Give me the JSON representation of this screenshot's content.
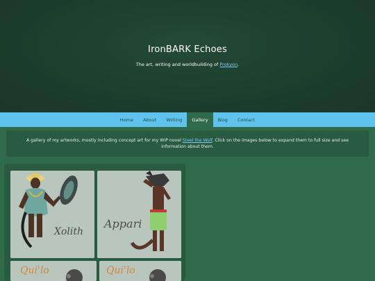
{
  "site": {
    "title": "IronBARK Echoes",
    "tagline_prefix": "The art, writing and worldbuilding of ",
    "tagline_link": "Prokyon",
    "tagline_suffix": "."
  },
  "nav": {
    "items": [
      {
        "label": "Home"
      },
      {
        "label": "About"
      },
      {
        "label": "Writing"
      },
      {
        "label": "Gallery",
        "active": true
      },
      {
        "label": "Blog"
      },
      {
        "label": "Contact"
      }
    ]
  },
  "intro": {
    "text_prefix": "A gallery of my artworks, mostly including concept art for my WIP novel ",
    "link": "Steel the Wolf",
    "text_suffix": ". Click on the images below to expand them to full size and see information about them."
  },
  "gallery": {
    "images": [
      {
        "caption": "Xolith"
      },
      {
        "caption": "Appari"
      },
      {
        "caption": "Qui'lo"
      },
      {
        "caption": "Qui'lo"
      }
    ]
  },
  "colors": {
    "hero_bg": "#1d3d2d",
    "nav_bg": "#60c3ee",
    "page_bg": "#2f6b4a",
    "panel_bg": "#285b40",
    "link": "#7fc8ff"
  }
}
